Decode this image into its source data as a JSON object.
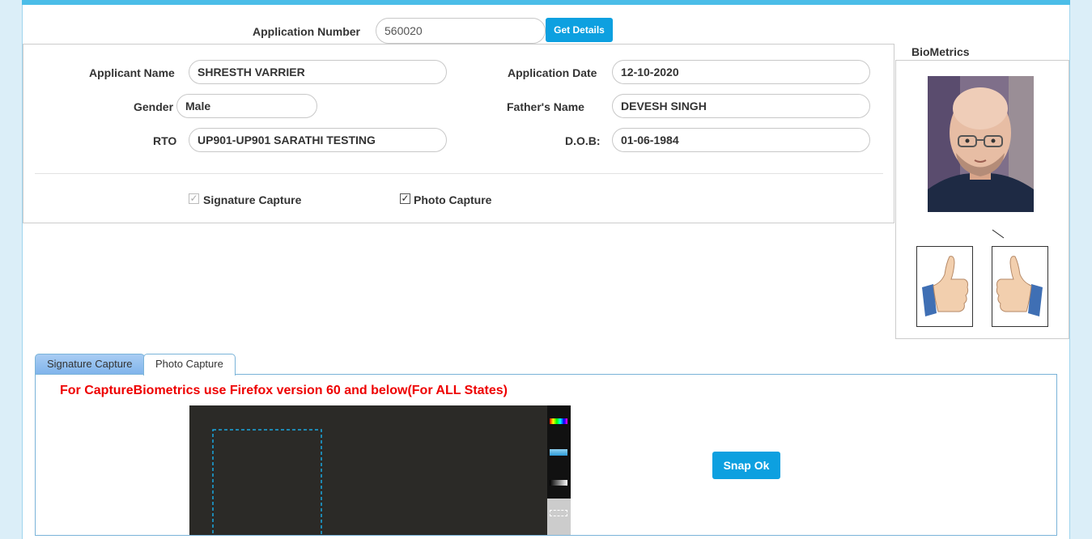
{
  "app_number": {
    "label": "Application Number",
    "value": "560020",
    "button": "Get Details"
  },
  "details": {
    "applicant_name_label": "Applicant Name",
    "applicant_name": "SHRESTH VARRIER",
    "application_date_label": "Application Date",
    "application_date": "12-10-2020",
    "gender_label": "Gender",
    "gender": "Male",
    "fathers_name_label": "Father's Name",
    "fathers_name": "DEVESH SINGH",
    "rto_label": "RTO",
    "rto": "UP901-UP901 SARATHI TESTING",
    "dob_label": "D.O.B:",
    "dob": "01-06-1984"
  },
  "captures": {
    "signature_label": "Signature Capture",
    "signature_checked": true,
    "photo_label": "Photo Capture",
    "photo_checked": true
  },
  "biometrics": {
    "title": "BioMetrics",
    "left_thumb": "thumbs-up-icon",
    "right_thumb": "thumbs-up-icon"
  },
  "tabs": [
    {
      "label": "Signature Capture",
      "active": false
    },
    {
      "label": "Photo Capture",
      "active": true
    }
  ],
  "warning": "For CaptureBiometrics use Firefox version 60 and below(For ALL States)",
  "snap_button": "Snap Ok",
  "colors": {
    "accent": "#0da0e0",
    "warning": "#e00000",
    "topbar": "#4bbde8"
  }
}
